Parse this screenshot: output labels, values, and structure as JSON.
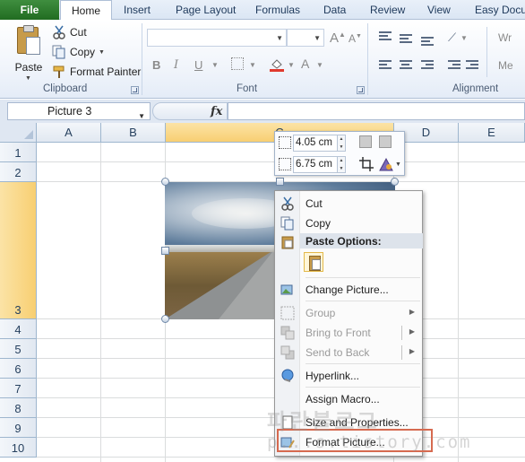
{
  "ribbon_tabs": {
    "file": "File",
    "home": "Home",
    "insert": "Insert",
    "page_layout": "Page Layout",
    "formulas": "Formulas",
    "data": "Data",
    "review": "Review",
    "view": "View",
    "easy_document": "Easy Docu"
  },
  "clipboard": {
    "paste": "Paste",
    "cut": "Cut",
    "copy": "Copy",
    "format_painter": "Format Painter",
    "group_label": "Clipboard"
  },
  "font": {
    "group_label": "Font",
    "bold": "B",
    "italic": "I",
    "underline": "U",
    "grow": "A",
    "shrink": "A",
    "font_color": "A"
  },
  "alignment": {
    "group_label": "Alignment",
    "wrap": "Wr",
    "merge": "Me"
  },
  "formula_bar": {
    "name_box": "Picture 3",
    "fx": "fx"
  },
  "columns": [
    "A",
    "B",
    "C",
    "D",
    "E"
  ],
  "rows": [
    "1",
    "2",
    "3",
    "4",
    "5",
    "6",
    "7",
    "8",
    "9",
    "10"
  ],
  "mini_toolbar": {
    "height_value": "4.05 cm",
    "width_value": "6.75 cm"
  },
  "context_menu": {
    "cut": "Cut",
    "copy": "Copy",
    "paste_options": "Paste Options:",
    "change_picture": "Change Picture...",
    "group": "Group",
    "bring_to_front": "Bring to Front",
    "send_to_back": "Send to Back",
    "hyperlink": "Hyperlink...",
    "assign_macro": "Assign Macro...",
    "size_and_properties": "Size and Properties...",
    "format_picture": "Format Picture..."
  },
  "watermark": {
    "text": "파란블로그",
    "url": "p...s.tistory.com"
  },
  "colors": {
    "file_tab": "#2a7a2a",
    "selected_column": "#f8cf72",
    "highlight_box": "#d66a50"
  }
}
